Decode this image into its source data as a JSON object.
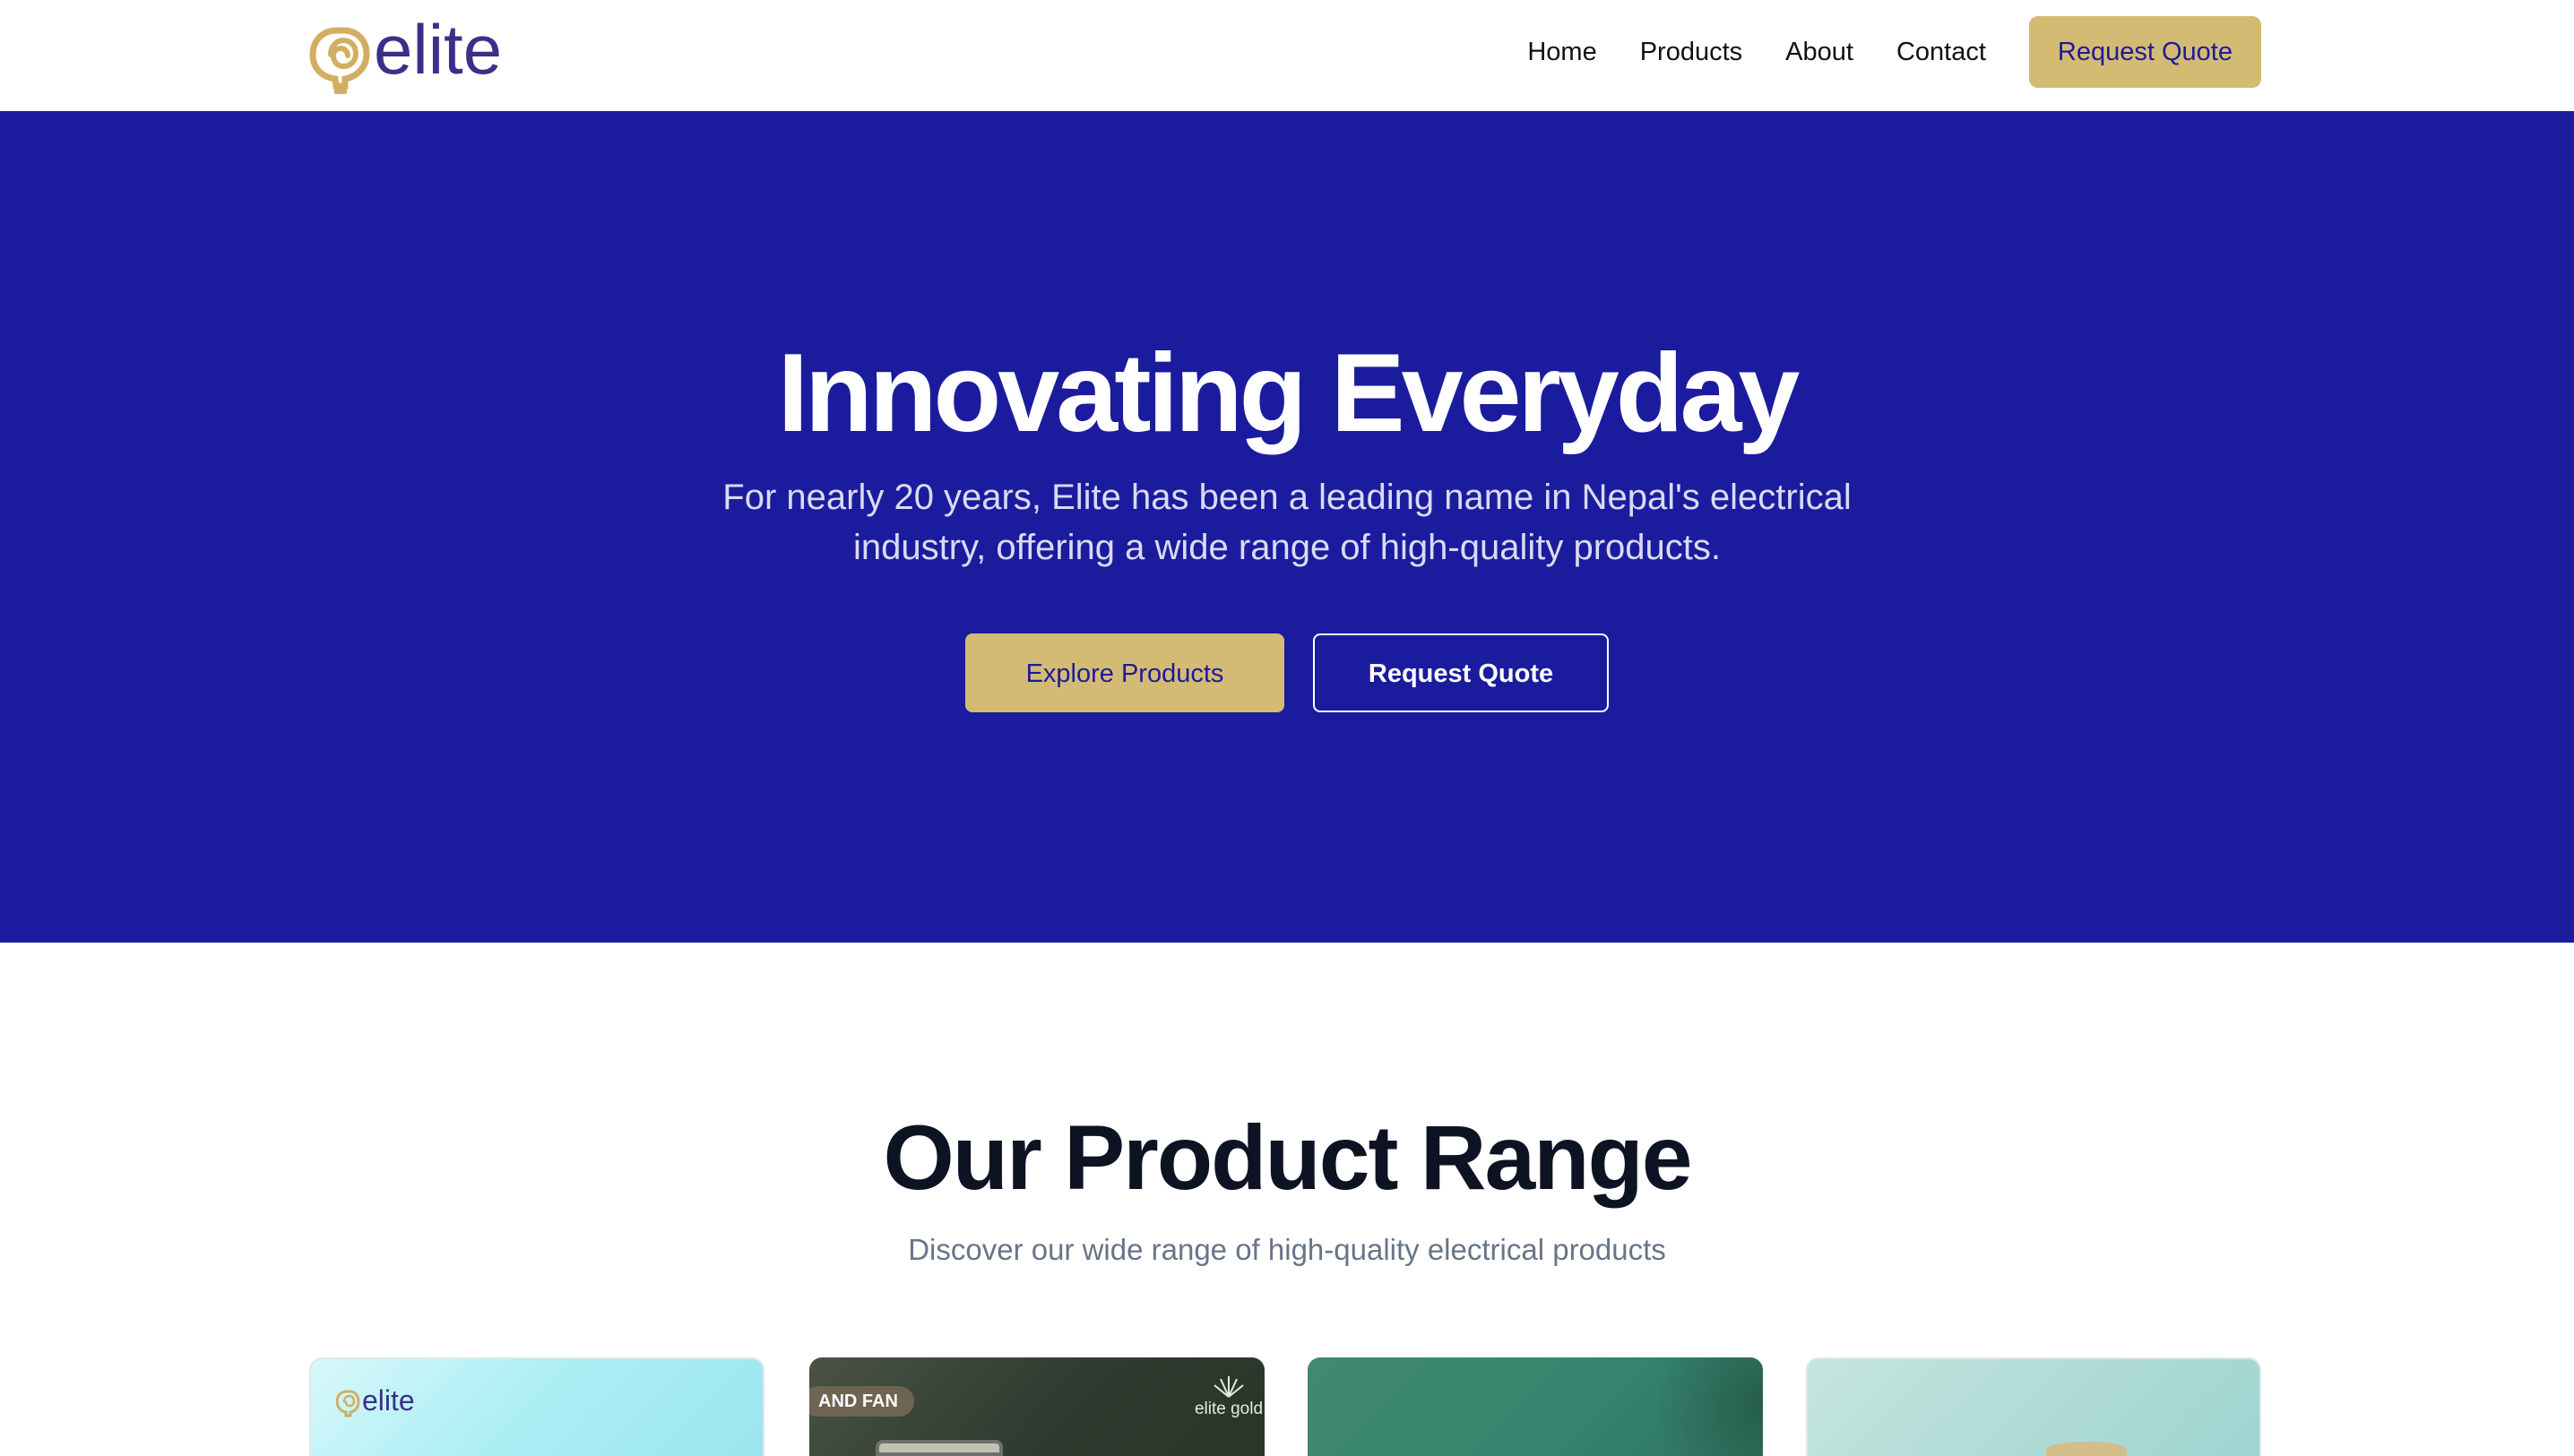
{
  "header": {
    "logo_text": "elite",
    "nav": [
      {
        "label": "Home"
      },
      {
        "label": "Products"
      },
      {
        "label": "About"
      },
      {
        "label": "Contact"
      }
    ],
    "cta_label": "Request Quote"
  },
  "hero": {
    "title": "Innovating Everyday",
    "subtitle": "For nearly 20 years, Elite has been a leading name in Nepal's electrical industry, offering a wide range of high-quality products.",
    "primary_button": "Explore Products",
    "secondary_button": "Request Quote"
  },
  "products": {
    "title": "Our Product Range",
    "subtitle": "Discover our wide range of high-quality electrical products",
    "cards": [
      {
        "logo_text": "elite"
      },
      {
        "badge": "AND FAN",
        "brand": "elite gold"
      },
      {},
      {}
    ]
  },
  "colors": {
    "brand_blue": "#1B1C9D",
    "brand_gold": "#D4BB74",
    "heading_dark": "#0D1323",
    "muted_text": "#687488"
  }
}
